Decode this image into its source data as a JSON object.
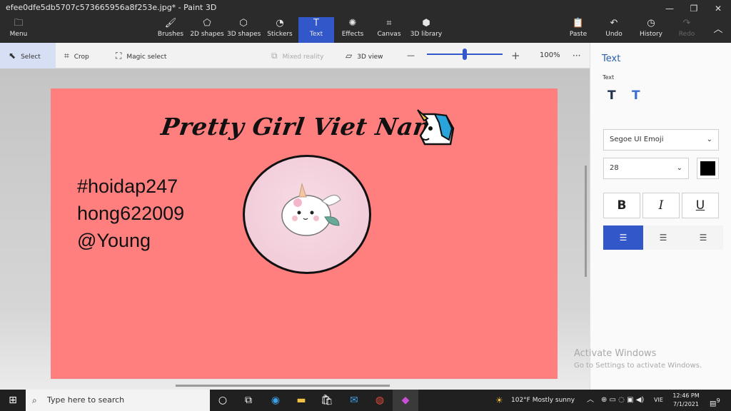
{
  "window": {
    "title": "efee0dfe5db5707c573665956a8f253e.jpg* - Paint 3D",
    "controls": [
      "—",
      "❐",
      "✕"
    ]
  },
  "ribbon": {
    "menu": {
      "icon": "folder-icon",
      "label": "Menu"
    },
    "tools": [
      {
        "icon": "brush-icon",
        "glyph": "🖌",
        "label": "Brushes"
      },
      {
        "icon": "shapes-2d-icon",
        "glyph": "⬠",
        "label": "2D shapes"
      },
      {
        "icon": "cube-icon",
        "glyph": "⬡",
        "label": "3D shapes"
      },
      {
        "icon": "sticker-icon",
        "glyph": "◔",
        "label": "Stickers"
      },
      {
        "icon": "text-icon",
        "glyph": "T",
        "label": "Text",
        "active": true
      },
      {
        "icon": "effects-icon",
        "glyph": "✺",
        "label": "Effects"
      },
      {
        "icon": "canvas-icon",
        "glyph": "⌗",
        "label": "Canvas"
      },
      {
        "icon": "3d-library-icon",
        "glyph": "⬢",
        "label": "3D library"
      }
    ],
    "actions": [
      {
        "icon": "paste-icon",
        "glyph": "📋",
        "label": "Paste"
      },
      {
        "icon": "undo-icon",
        "glyph": "↶",
        "label": "Undo"
      },
      {
        "icon": "history-icon",
        "glyph": "◷",
        "label": "History"
      },
      {
        "icon": "redo-icon",
        "glyph": "↷",
        "label": "Redo",
        "disabled": true
      }
    ],
    "collapse_glyph": "︿"
  },
  "toolbar": {
    "select_label": "Select",
    "crop_label": "Crop",
    "magic_select_label": "Magic select",
    "mixed_reality_label": "Mixed reality",
    "view_3d_label": "3D view",
    "zoom_out": "—",
    "zoom_in": "+",
    "zoom_level": "100%",
    "more": "···",
    "zoom_fraction": 0.5
  },
  "canvas": {
    "background": "#ff7f7f",
    "title": "Pretty Girl Viet Nam",
    "lines": [
      "#hoidap247",
      "hong622009",
      "@Young"
    ]
  },
  "panel": {
    "title": "Text",
    "subtitle": "Text",
    "font_name": "Segoe UI Emoji",
    "font_size": "28",
    "color": "#000000",
    "bold": "B",
    "italic": "I",
    "underline": "U"
  },
  "watermark": {
    "line1": "Activate Windows",
    "line2": "Go to Settings to activate Windows."
  },
  "taskbar": {
    "search_placeholder": "Type here to search",
    "weather": "102°F  Mostly sunny",
    "language": "VIE",
    "time": "12:46 PM",
    "date": "7/1/2021",
    "notifications": "9"
  },
  "colors": {
    "accent": "#3257c9",
    "panel_title": "#2a5fa8"
  }
}
